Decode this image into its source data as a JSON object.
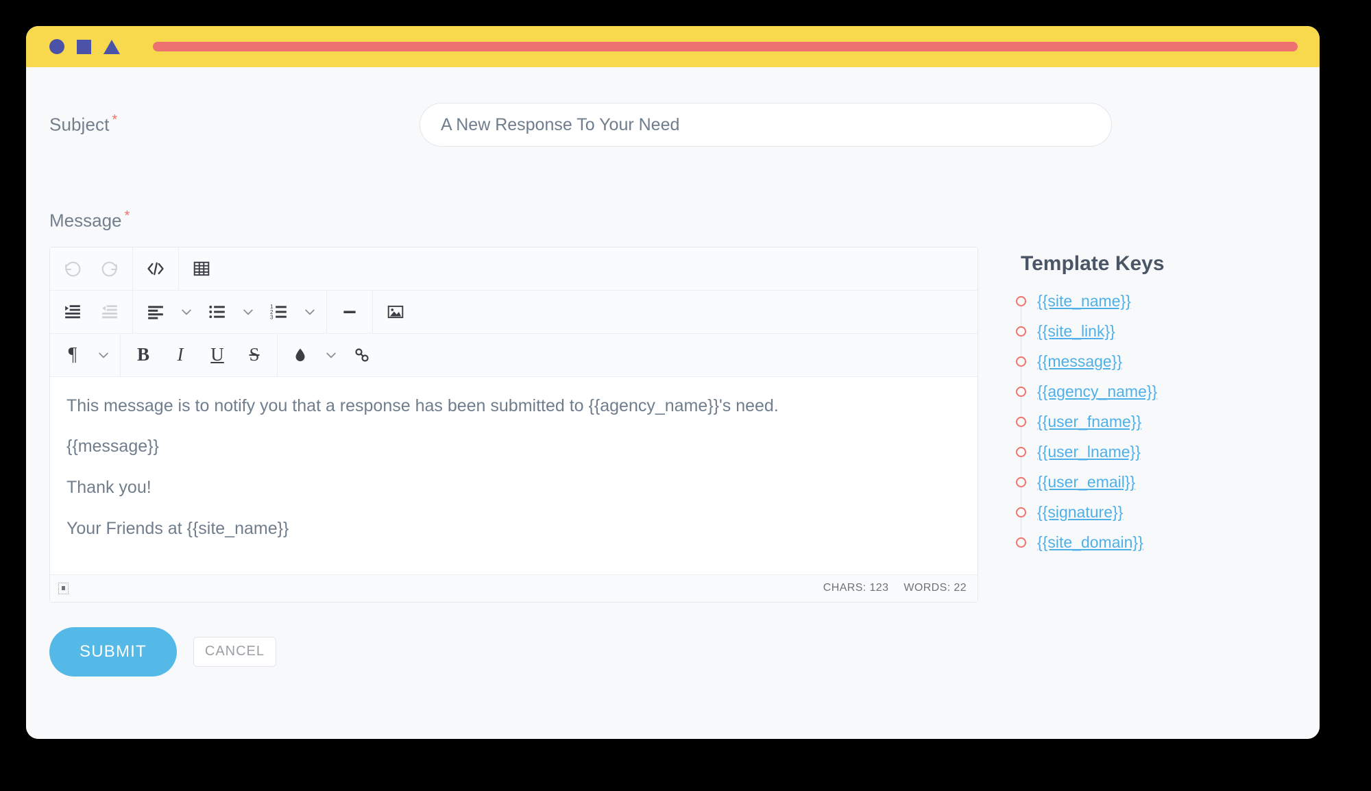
{
  "window": {
    "titlebar": {
      "dot_circle": "circle-dot",
      "dot_square": "square-dot",
      "dot_triangle": "triangle-dot",
      "addressbar_value": ""
    }
  },
  "form": {
    "subject": {
      "label": "Subject",
      "required_marker": "*",
      "value": "A New Response To Your Need",
      "placeholder": "Subject"
    },
    "message": {
      "label": "Message",
      "required_marker": "*"
    }
  },
  "editor": {
    "toolbar_rows": [
      {
        "groups": [
          {
            "items": [
              {
                "name": "undo-icon",
                "label": "Undo",
                "disabled": true
              },
              {
                "name": "redo-icon",
                "label": "Redo",
                "disabled": true
              }
            ]
          },
          {
            "items": [
              {
                "name": "code-view-icon",
                "label": "Code View",
                "glyph": "</>"
              }
            ]
          },
          {
            "items": [
              {
                "name": "table-icon",
                "label": "Table"
              }
            ]
          }
        ]
      },
      {
        "groups": [
          {
            "items": [
              {
                "name": "indent-icon",
                "label": "Indent"
              },
              {
                "name": "outdent-icon",
                "label": "Outdent",
                "disabled": true
              }
            ]
          },
          {
            "items": [
              {
                "name": "align-left-icon",
                "label": "Align",
                "caret": true
              },
              {
                "name": "unordered-list-icon",
                "label": "Unordered List",
                "caret": true
              },
              {
                "name": "ordered-list-icon",
                "label": "Ordered List",
                "caret": true
              }
            ]
          },
          {
            "items": [
              {
                "name": "horizontal-rule-icon",
                "label": "Horizontal Line"
              }
            ]
          },
          {
            "items": [
              {
                "name": "image-icon",
                "label": "Insert Image"
              }
            ]
          }
        ]
      },
      {
        "groups": [
          {
            "items": [
              {
                "name": "paragraph-format-icon",
                "label": "Paragraph Format",
                "glyph": "¶",
                "caret": true
              }
            ]
          },
          {
            "items": [
              {
                "name": "bold-icon",
                "label": "Bold",
                "glyph": "B"
              },
              {
                "name": "italic-icon",
                "label": "Italic",
                "glyph": "I"
              },
              {
                "name": "underline-icon",
                "label": "Underline",
                "glyph": "U"
              },
              {
                "name": "strikethrough-icon",
                "label": "Strikethrough",
                "glyph": "S"
              }
            ]
          },
          {
            "items": [
              {
                "name": "text-color-icon",
                "label": "Colors",
                "caret": true
              },
              {
                "name": "link-icon",
                "label": "Insert Link"
              }
            ]
          }
        ]
      }
    ],
    "body_paragraphs": [
      "This message is to notify you that a response has been submitted to {{agency_name}}'s need.",
      "{{message}}",
      "Thank you!",
      "Your Friends at {{site_name}}"
    ],
    "status": {
      "resize_handle": "resize-handle-icon",
      "chars": "CHARS: 123",
      "words": "WORDS: 22"
    }
  },
  "template_keys": {
    "title": "Template Keys",
    "items": [
      {
        "label": "{{site_name}}"
      },
      {
        "label": "{{site_link}}"
      },
      {
        "label": "{{message}}"
      },
      {
        "label": "{{agency_name}}"
      },
      {
        "label": "{{user_fname}}"
      },
      {
        "label": "{{user_lname}}"
      },
      {
        "label": "{{user_email}}"
      },
      {
        "label": "{{signature}}"
      },
      {
        "label": "{{site_domain}}"
      }
    ]
  },
  "actions": {
    "submit_label": "SUBMIT",
    "cancel_label": "CANCEL"
  },
  "colors": {
    "titlebar": "#f8d94e",
    "addressbar": "#ee7171",
    "window_shape": "#4a53a8",
    "required": "#f4726a",
    "link": "#4fb0e8",
    "submit": "#55b9e8",
    "page_bg": "#f8f9fb",
    "text": "#6f7d8c"
  }
}
